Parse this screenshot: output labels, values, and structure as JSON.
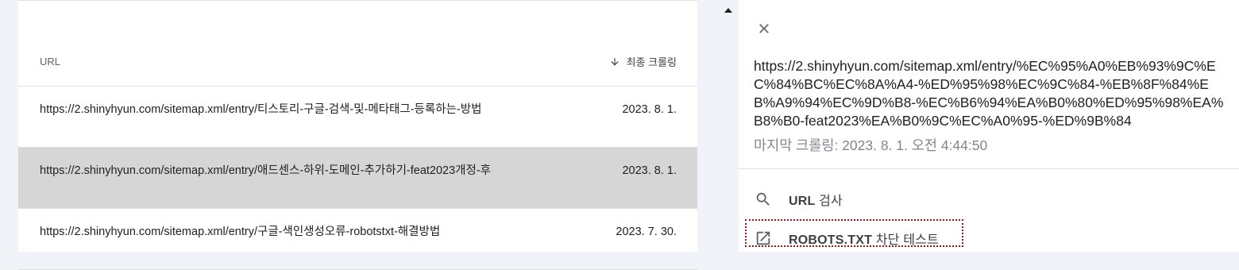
{
  "table": {
    "columns": {
      "url": "URL",
      "last_crawl": "최종 크롤링"
    },
    "rows": [
      {
        "url": "https://2.shinyhyun.com/sitemap.xml/entry/티스토리-구글-검색-및-메타태그-등록하는-방법",
        "date": "2023. 8. 1.",
        "selected": false
      },
      {
        "url": "https://2.shinyhyun.com/sitemap.xml/entry/애드센스-하위-도메인-추가하기-feat2023개정-후",
        "date": "2023. 8. 1.",
        "selected": true
      },
      {
        "url": "https://2.shinyhyun.com/sitemap.xml/entry/구글-색인생성오류-robotstxt-해결방법",
        "date": "2023. 7. 30.",
        "selected": false
      }
    ]
  },
  "panel": {
    "url": "https://2.shinyhyun.com/sitemap.xml/entry/%EC%95%A0%EB%93%9C%EC%84%BC%EC%8A%A4-%ED%95%98%EC%9C%84-%EB%8F%84%EB%A9%94%EC%9D%B8-%EC%B6%94%EA%B0%80%ED%95%98%EA%B8%B0-feat2023%EA%B0%9C%EC%A0%95-%ED%9B%84",
    "last_crawl": "마지막 크롤링: 2023. 8. 1. 오전 4:44:50",
    "actions": {
      "inspect_bold": "URL",
      "inspect_rest": " 검사",
      "robots_bold": "ROBOTS.TXT",
      "robots_rest": " 차단 테스트"
    }
  },
  "icons": {
    "sort": "arrow-down-icon",
    "close": "close-icon",
    "search": "search-icon",
    "external": "open-in-new-icon"
  },
  "colors": {
    "selected_row": "#d6d6d6",
    "focus_outline": "#8b1a1a"
  }
}
